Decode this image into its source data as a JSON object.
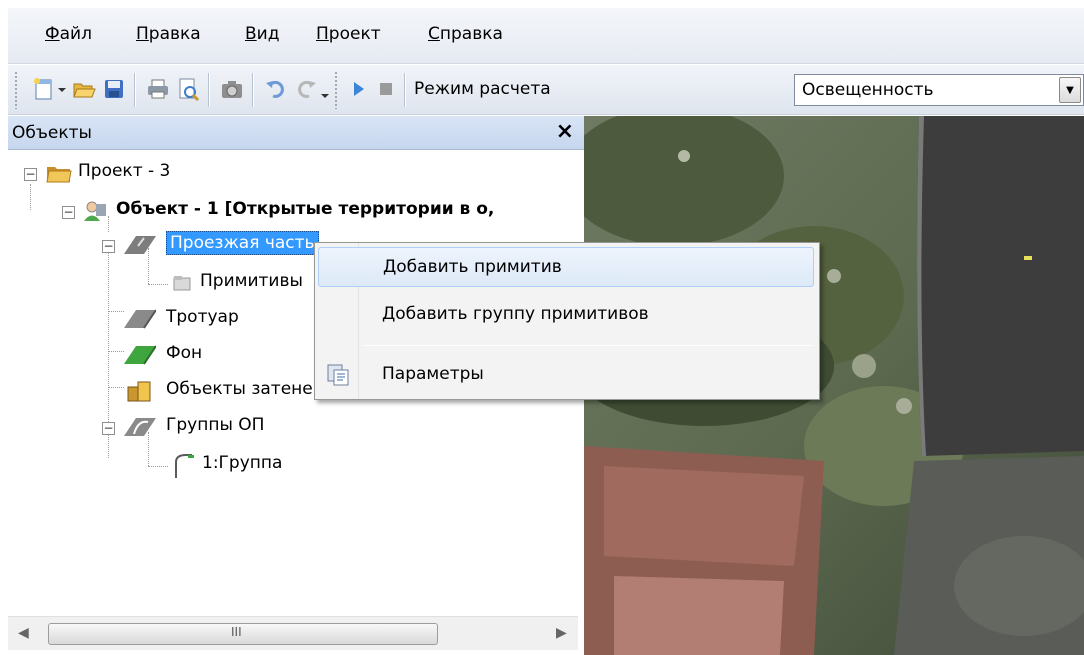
{
  "menu": {
    "items": [
      {
        "underline": "Ф",
        "rest": "айл"
      },
      {
        "underline": "П",
        "rest": "равка"
      },
      {
        "underline": "В",
        "rest": "ид"
      },
      {
        "underline": "П",
        "rest": "роект"
      },
      {
        "underline": "С",
        "rest": "правка"
      }
    ]
  },
  "toolbar": {
    "mode_label": "Режим расчета",
    "mode_value": "Освещенность",
    "icons": [
      "new-document-icon",
      "dropdown-icon",
      "open-folder-icon",
      "save-icon",
      "print-icon",
      "print-preview-icon",
      "camera-icon",
      "undo-icon",
      "redo-icon",
      "play-icon",
      "stop-icon"
    ]
  },
  "panel": {
    "title": "Объекты",
    "close": "×",
    "tree": {
      "project": "Проект - 3",
      "object": "Объект - 1 [Открытые территории в о,",
      "roadway": "Проезжая часть",
      "primitives": "Примитивы",
      "sidewalk": "Тротуар",
      "background": "Фон",
      "shading": "Объекты затенения",
      "groups": "Группы ОП",
      "group1": "1:Группа"
    },
    "scrollbar_grip": "III"
  },
  "context_menu": {
    "items": [
      {
        "label": "Добавить примитив"
      },
      {
        "label": "Добавить группу примитивов"
      },
      {
        "label": "Параметры"
      }
    ]
  },
  "colors": {
    "selection": "#3399ff",
    "menu_hover": "#dde9f8",
    "panel_header": "#c6d6ee"
  }
}
